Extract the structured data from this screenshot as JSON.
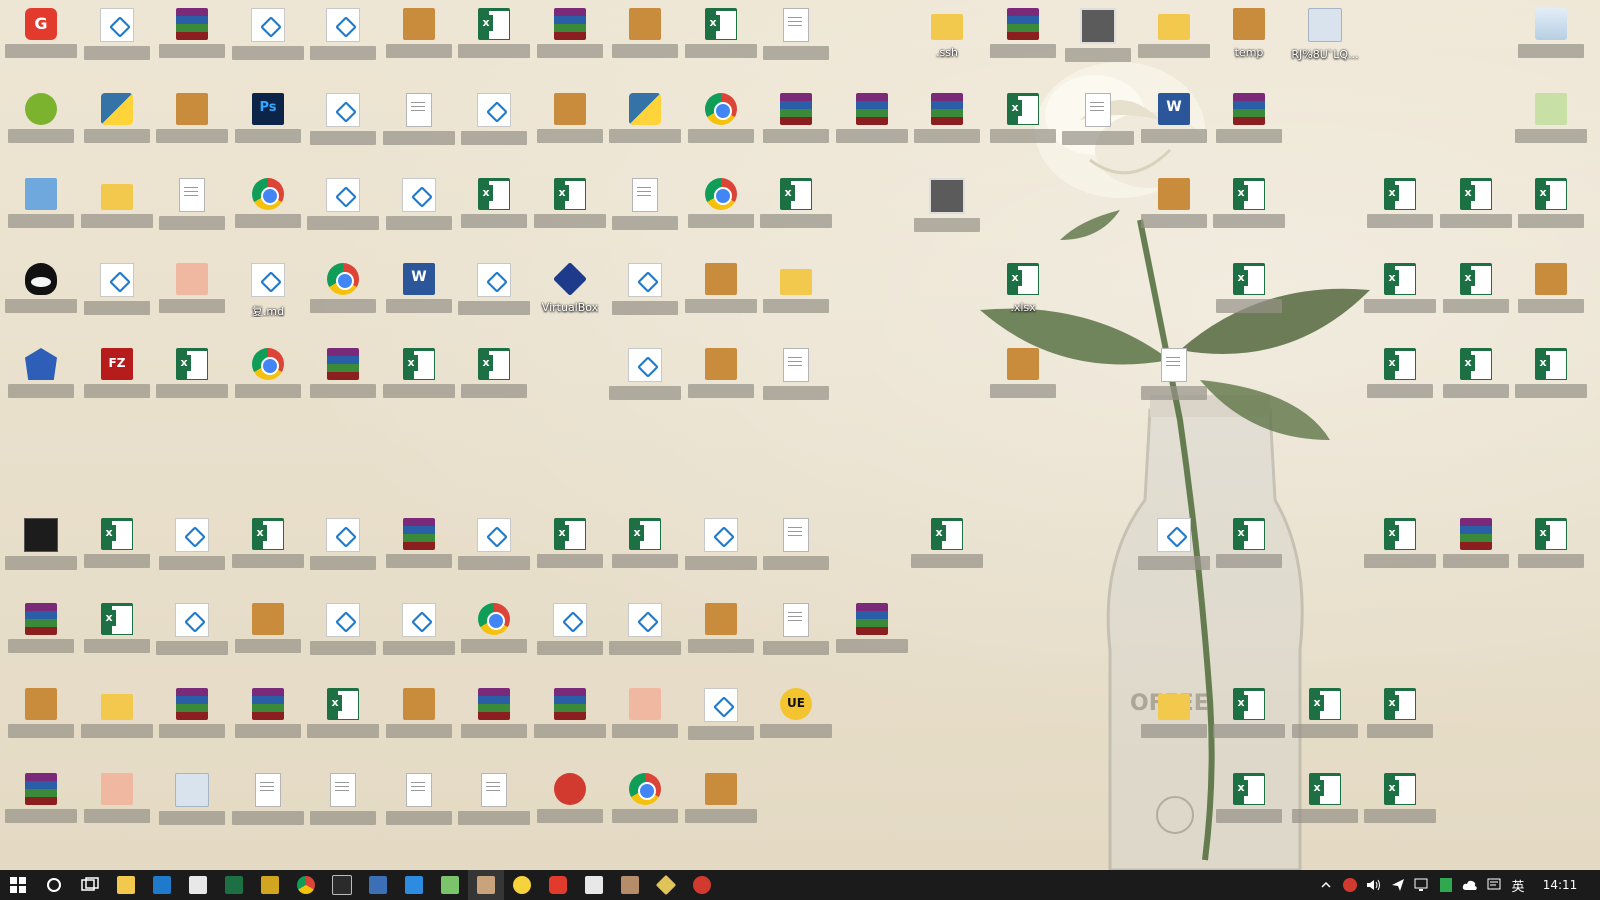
{
  "desktop": {
    "icons": [
      {
        "type": "app-red",
        "label": ""
      },
      {
        "type": "vs",
        "label": ""
      },
      {
        "type": "rar",
        "label": ""
      },
      {
        "type": "vs",
        "label": ""
      },
      {
        "type": "vs",
        "label": ""
      },
      {
        "type": "book",
        "label": ""
      },
      {
        "type": "xls",
        "label": ""
      },
      {
        "type": "rar",
        "label": ""
      },
      {
        "type": "book",
        "label": ""
      },
      {
        "type": "xls",
        "label": ""
      },
      {
        "type": "txt",
        "label": ""
      },
      {
        "type": "folder",
        "label": ".ssh"
      },
      {
        "type": "rar",
        "label": ""
      },
      {
        "type": "thumb",
        "label": ""
      },
      {
        "type": "folder",
        "label": ""
      },
      {
        "type": "book",
        "label": "temp"
      },
      {
        "type": "shortcut-gen",
        "label": "RJ%8U`LQ..."
      },
      {
        "type": "recycle",
        "label": ""
      }
    ],
    "notable_labels": {
      "virtualbox": "VirtualBox",
      "md_file": "复.md",
      "xlsx_file": ".xlsx"
    }
  },
  "taskbar": {
    "apps": [
      {
        "name": "start",
        "icon": "windows-icon"
      },
      {
        "name": "search",
        "icon": "cortana-circle-icon"
      },
      {
        "name": "task-view",
        "icon": "task-view-icon"
      },
      {
        "name": "file-explorer",
        "icon": "folder-icon"
      },
      {
        "name": "vscode",
        "icon": "vs-icon"
      },
      {
        "name": "store",
        "icon": "store-icon"
      },
      {
        "name": "excel",
        "icon": "excel-icon"
      },
      {
        "name": "notes",
        "icon": "notes-icon"
      },
      {
        "name": "chrome",
        "icon": "chrome-icon"
      },
      {
        "name": "terminal",
        "icon": "cmd-icon"
      },
      {
        "name": "remote",
        "icon": "remote-icon"
      },
      {
        "name": "snipping",
        "icon": "scissors-icon"
      },
      {
        "name": "explorer-2",
        "icon": "folder-green-icon"
      },
      {
        "name": "active-app",
        "icon": "app-icon"
      },
      {
        "name": "chick",
        "icon": "chick-icon"
      },
      {
        "name": "netease",
        "icon": "netease-icon"
      },
      {
        "name": "calculator",
        "icon": "calculator-icon"
      },
      {
        "name": "hand-tool",
        "icon": "hand-icon"
      },
      {
        "name": "git",
        "icon": "git-icon"
      },
      {
        "name": "app-red",
        "icon": "red-app-icon"
      }
    ],
    "tray": {
      "ime": "英",
      "time": "14:11"
    }
  }
}
